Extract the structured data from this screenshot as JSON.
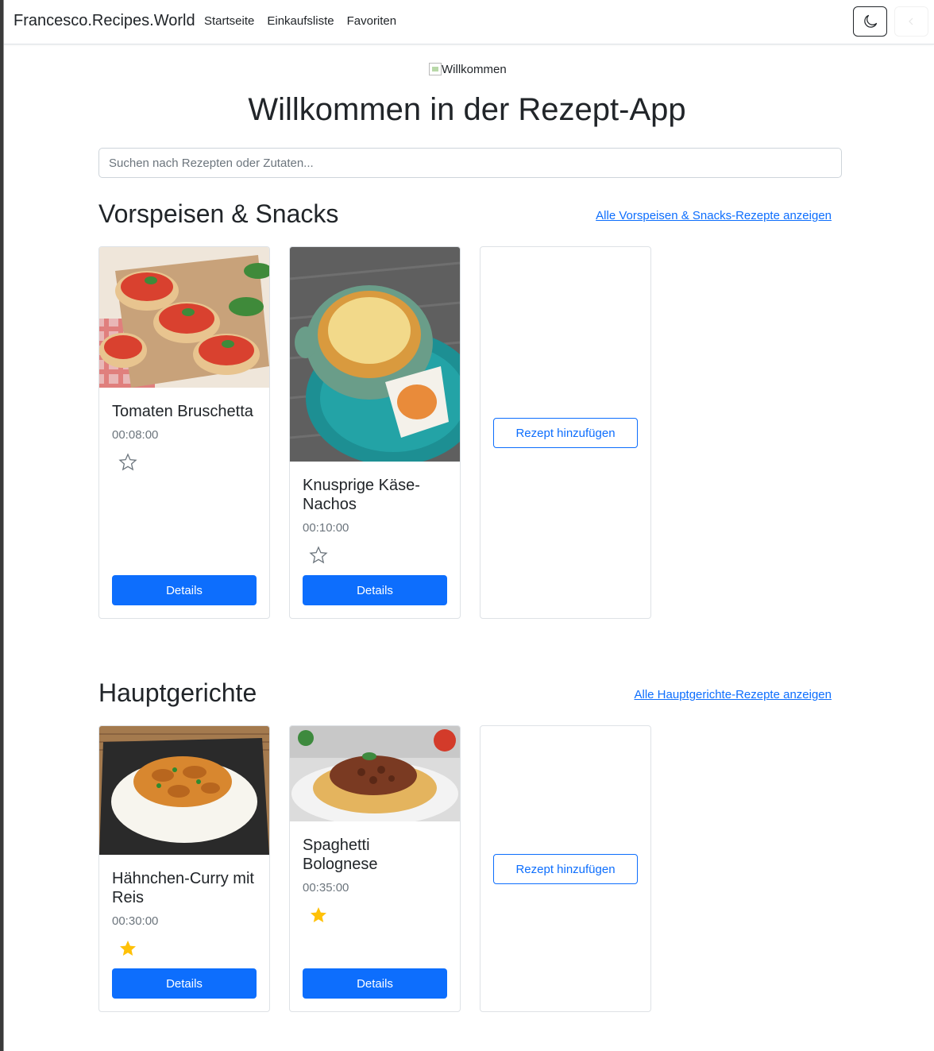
{
  "navbar": {
    "brand": "Francesco.Recipes.World",
    "links": [
      "Startseite",
      "Einkaufsliste",
      "Favoriten"
    ],
    "theme_icon": "moon-icon"
  },
  "hero": {
    "image_alt": "Willkommen",
    "title": "Willkommen in der Rezept-App"
  },
  "search": {
    "placeholder": "Suchen nach Rezepten oder Zutaten..."
  },
  "sections": [
    {
      "title": "Vorspeisen & Snacks",
      "link": "Alle Vorspeisen & Snacks-Rezepte anzeigen",
      "recipes": [
        {
          "title": "Tomaten Bruschetta",
          "time": "00:08:00",
          "favorite": false,
          "details": "Details"
        },
        {
          "title": "Knusprige Käse-Nachos",
          "time": "00:10:00",
          "favorite": false,
          "details": "Details"
        }
      ],
      "add_label": "Rezept hinzufügen"
    },
    {
      "title": "Hauptgerichte",
      "link": "Alle Hauptgerichte-Rezepte anzeigen",
      "recipes": [
        {
          "title": "Hähnchen-Curry mit Reis",
          "time": "00:30:00",
          "favorite": true,
          "details": "Details"
        },
        {
          "title": "Spaghetti Bolognese",
          "time": "00:35:00",
          "favorite": true,
          "details": "Details"
        }
      ],
      "add_label": "Rezept hinzufügen"
    }
  ],
  "colors": {
    "primary": "#0d6efd",
    "star_filled": "#ffc107",
    "star_empty": "#6c757d"
  }
}
